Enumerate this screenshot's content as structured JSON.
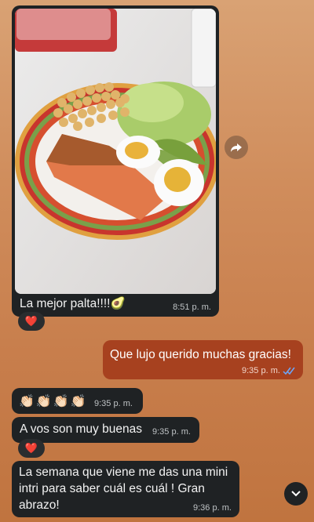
{
  "messages": [
    {
      "caption": "La mejor palta!!!!",
      "emoji": "🥑",
      "time": "8:51 p. m.",
      "reaction": "❤️"
    },
    {
      "text": "Que lujo querido muchas gracias!",
      "time": "9:35 p. m."
    },
    {
      "emojis": "👏🏻👏🏻👏🏻👏🏻",
      "time": "9:35 p. m."
    },
    {
      "text": "A vos son muy buenas",
      "time": "9:35 p. m.",
      "reaction": "❤️"
    },
    {
      "text": "La semana que viene me das una mini intri para saber cuál es cuál ! Gran abrazo!",
      "time": "9:36 p. m."
    }
  ],
  "icons": {
    "forward": "forward-arrow-icon",
    "scroll": "chevron-down-icon",
    "read": "double-check-icon"
  },
  "colors": {
    "incoming": "#1f2224",
    "outgoing": "#a7411f",
    "read_check": "#6aa8ff"
  }
}
